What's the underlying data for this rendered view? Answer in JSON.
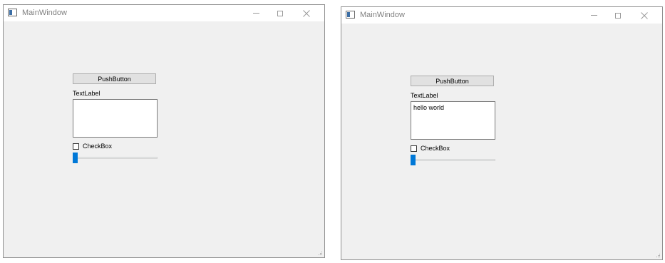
{
  "windows": [
    {
      "title": "MainWindow",
      "push_button_label": "PushButton",
      "text_label": "TextLabel",
      "text_edit_value": "",
      "checkbox_label": "CheckBox",
      "checkbox_checked": false,
      "slider_value": 0
    },
    {
      "title": "MainWindow",
      "push_button_label": "PushButton",
      "text_label": "TextLabel",
      "text_edit_value": "hello world",
      "checkbox_label": "CheckBox",
      "checkbox_checked": false,
      "slider_value": 0
    }
  ],
  "colors": {
    "accent": "#0078d7",
    "window_bg": "#f0f0f0",
    "titlebar_bg": "#ffffff"
  }
}
